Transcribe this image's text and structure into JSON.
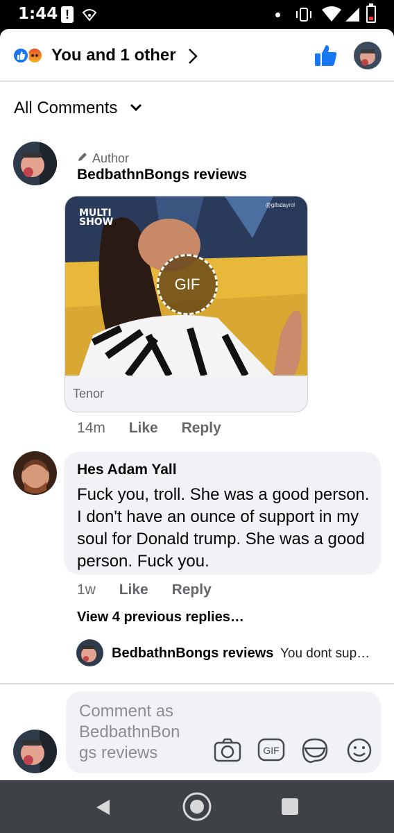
{
  "status_bar": {
    "time": "1:44",
    "alert_glyph": "!",
    "icons": [
      "alert-icon",
      "wifi-icon",
      "vibrate-icon",
      "signal-icon",
      "battery-low-icon"
    ]
  },
  "header": {
    "reactions": [
      "like",
      "angry"
    ],
    "reactions_text": "You and 1 other",
    "like_icon_color": "#1877f2"
  },
  "filter": {
    "label": "All Comments"
  },
  "comments": [
    {
      "badge": "Author",
      "author": "BedbathnBongs reviews",
      "attachment": {
        "type": "GIF",
        "overlay_label": "GIF",
        "watermark_left": "MULTI\nSHOW",
        "watermark_right": "@gifsdayrol",
        "source": "Tenor"
      },
      "time": "14m",
      "like_label": "Like",
      "reply_label": "Reply"
    },
    {
      "author": "Hes Adam Yall",
      "text": "Fuck you, troll. She was a good person. I don't have an ounce of support in my soul for Donald trump. She was a good person. Fuck you.",
      "time": "1w",
      "like_label": "Like",
      "reply_label": "Reply",
      "view_replies": "View 4 previous replies…",
      "latest_reply": {
        "author": "BedbathnBongs reviews",
        "preview": "You dont sup…"
      }
    }
  ],
  "composer": {
    "placeholder": "Comment as BedbathnBon gs reviews",
    "icons": [
      "camera-icon",
      "gif-icon",
      "sticker-icon",
      "emoji-icon"
    ]
  },
  "colors": {
    "brand_blue": "#1877f2",
    "bubble_bg": "#f0f2f5",
    "secondary_text": "#65676b",
    "nav_bar": "#3e4246"
  }
}
